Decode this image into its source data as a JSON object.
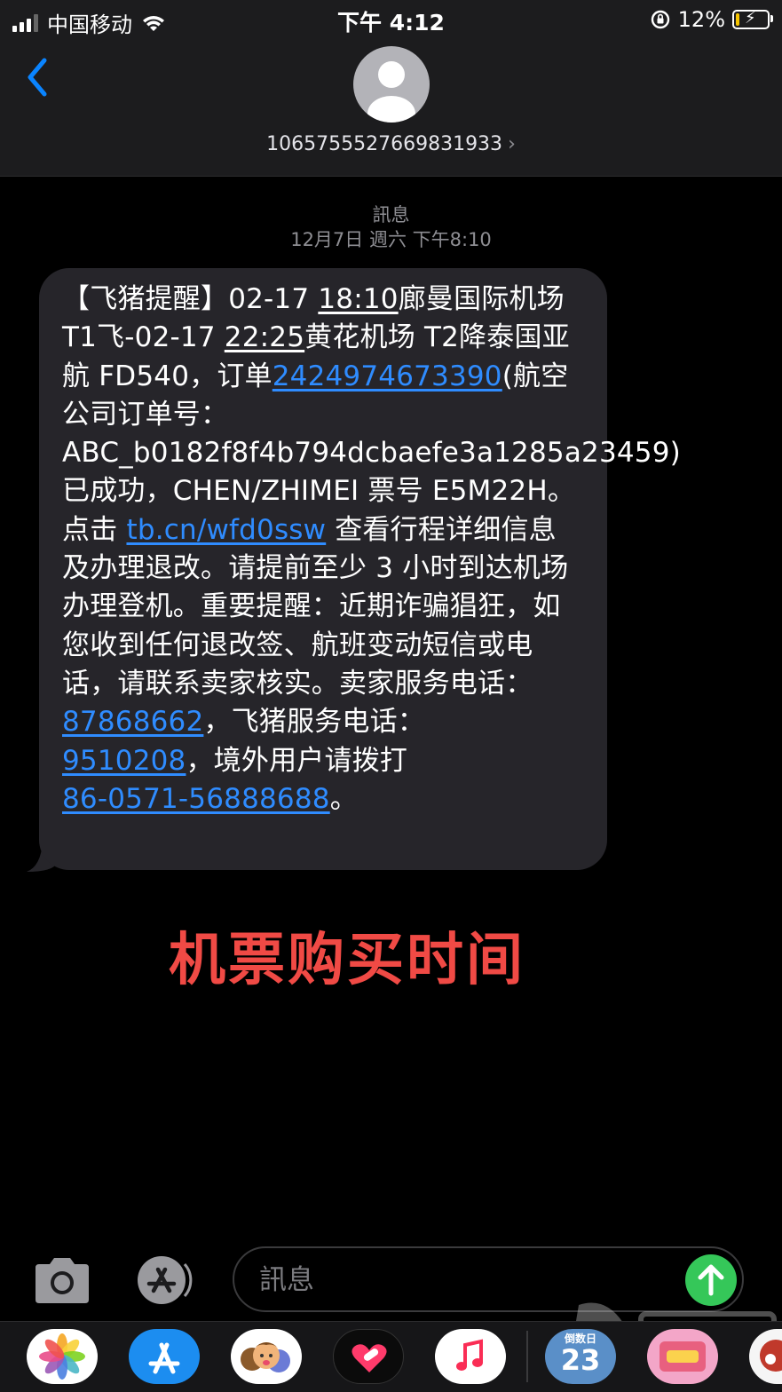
{
  "status_bar": {
    "carrier": "中国移动",
    "time": "下午 4:12",
    "battery_percent": "12%",
    "battery_level": 0.12,
    "battery_color": "#f5c400"
  },
  "header": {
    "contact": "1065755527669831933",
    "avatar_icon": "person-icon"
  },
  "thread": {
    "label": "訊息",
    "date": "12月7日 週六 下午8:10"
  },
  "message": {
    "p1": "【飞猪提醒】02-17 ",
    "dep_time": "18:10",
    "p2": "廊曼国际机场 T1飞-02-17 ",
    "arr_time": "22:25",
    "p3": "黄花机场 T2降泰国亚航 FD540，订单",
    "order_no": "2424974673390",
    "p4": "(航空公司订单号：ABC_b0182f8f4b794dcbaefe3a1285a23459)已成功，CHEN/ZHIMEI 票号 E5M22H。点击 ",
    "link": "tb.cn/wfd0ssw",
    "p5": " 查看行程详细信息及办理退改。请提前至少 3 小时到达机场办理登机。重要提醒：近期诈骗猖狂，如您收到任何退改签、航班变动短信或电话，请联系卖家核实。卖家服务电话：",
    "phone_seller": "87868662",
    "p6": "，飞猪服务电话：",
    "phone_feizhu": "9510208",
    "p7": "，境外用户请拨打",
    "phone_intl": "86-0571-56888688",
    "p8": "。"
  },
  "annotation": "机票购买时间",
  "input": {
    "placeholder": "訊息"
  },
  "dock": {
    "apps": [
      "photos-icon",
      "app-store-icon",
      "memoji-icon",
      "digital-touch-icon",
      "music-icon",
      "countdown-icon",
      "sticker-icon",
      "sticker-icon-2"
    ],
    "countdown_label": "倒数日",
    "countdown_number": "23"
  },
  "colors": {
    "link": "#2f8cff",
    "annotation": "#f04a45",
    "send": "#35c759",
    "back": "#0a84ff"
  }
}
